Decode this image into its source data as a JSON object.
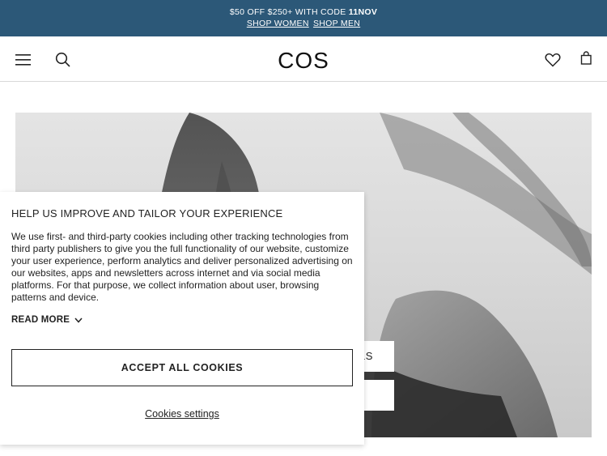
{
  "promo": {
    "text": "$50 OFF $250+ WITH CODE ",
    "code": "11NOV",
    "link_women": "SHOP WOMEN",
    "link_men": "SHOP MEN"
  },
  "header": {
    "logo": "COS",
    "icons": [
      "menu-icon",
      "search-icon",
      "heart-icon",
      "bag-icon"
    ]
  },
  "hero": {
    "button_1_label": "LS",
    "button_2_label": ""
  },
  "cookie_banner": {
    "title": "HELP US IMPROVE AND TAILOR YOUR EXPERIENCE",
    "body": "We use first- and third-party cookies including other tracking technologies from third party publishers to give you the full functionality of our website, customize your user experience, perform analytics and deliver personalized advertising on our websites, apps and newsletters across internet and via social media platforms. For that purpose, we collect information about user, browsing patterns and device.",
    "read_more": "READ MORE",
    "accept_label": "ACCEPT ALL COOKIES",
    "settings_label": "Cookies settings"
  },
  "colors": {
    "promo_bg": "#2c5878",
    "text": "#222222",
    "background": "#ffffff"
  }
}
